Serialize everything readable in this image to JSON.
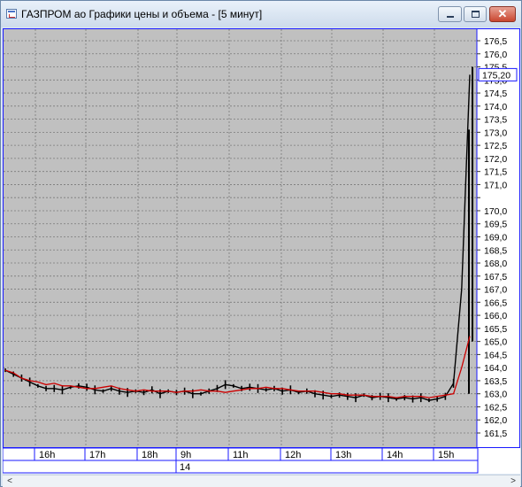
{
  "window": {
    "title": "ГАЗПРОМ ао Графики цены и объема - [5 минут]",
    "close_glyph": "✕",
    "scroll_left": "<",
    "scroll_right": ">"
  },
  "chart_data": {
    "type": "line",
    "title": "",
    "ylim": [
      161.2,
      176.8
    ],
    "y_ticks": [
      "176,5",
      "176,0",
      "175,5",
      "175,0",
      "174,5",
      "174,0",
      "173,5",
      "173,0",
      "172,5",
      "172,0",
      "171,5",
      "171,0",
      "170,0",
      "169,5",
      "169,0",
      "168,5",
      "168,0",
      "167,5",
      "167,0",
      "166,5",
      "166,0",
      "165,5",
      "165,0",
      "164,5",
      "164,0",
      "163,5",
      "163,0",
      "162,5",
      "162,0",
      "161,5"
    ],
    "y_tick_values": [
      176.5,
      176.0,
      175.5,
      175.0,
      174.5,
      174.0,
      173.5,
      173.0,
      172.5,
      172.0,
      171.5,
      171.0,
      170.0,
      169.5,
      169.0,
      168.5,
      168.0,
      167.5,
      167.0,
      166.5,
      166.0,
      165.5,
      165.0,
      164.5,
      164.0,
      163.5,
      163.0,
      162.5,
      162.0,
      161.5
    ],
    "x_session_labels": [
      "16h",
      "17h",
      "18h",
      "9h",
      "11h",
      "12h",
      "13h",
      "14h",
      "15h"
    ],
    "x_date_label": "14",
    "last_price_label": "175,20",
    "last_price": 175.2,
    "grid": true,
    "colors": {
      "background": "#c0c0c0",
      "grid": "#7a7a7a",
      "price": "#000000",
      "average": "#cc0000",
      "axis_frame": "#1a1aff"
    },
    "series": [
      {
        "values": [
          163.9,
          163.8,
          163.6,
          163.5,
          163.45,
          163.35,
          163.4,
          163.3,
          163.3,
          163.25,
          163.2,
          163.2,
          163.25,
          163.3,
          163.2,
          163.15,
          163.1,
          163.15,
          163.1,
          163.1,
          163.1,
          163.05,
          163.1,
          163.1,
          163.15,
          163.1,
          163.1,
          163.05,
          163.1,
          163.15,
          163.2,
          163.2,
          163.25,
          163.2,
          163.2,
          163.15,
          163.1,
          163.1,
          163.1,
          163.05,
          163.0,
          163.0,
          162.95,
          162.95,
          162.95,
          162.9,
          162.9,
          162.9,
          162.85,
          162.9,
          162.9,
          162.9,
          162.85,
          162.9,
          162.95,
          163.0,
          164.0,
          165.2
        ]
      },
      {
        "values": [
          163.9,
          163.75,
          163.6,
          163.45,
          163.3,
          163.2,
          163.2,
          163.15,
          163.25,
          163.3,
          163.25,
          163.15,
          163.1,
          163.2,
          163.1,
          163.05,
          163.1,
          163.05,
          163.15,
          163.0,
          163.1,
          163.05,
          163.1,
          163.0,
          163.0,
          163.1,
          163.2,
          163.35,
          163.3,
          163.2,
          163.25,
          163.2,
          163.15,
          163.2,
          163.1,
          163.15,
          163.05,
          163.1,
          163.0,
          162.95,
          162.9,
          162.95,
          162.9,
          162.85,
          162.95,
          162.85,
          162.9,
          162.85,
          162.8,
          162.85,
          162.8,
          162.85,
          162.75,
          162.8,
          162.9,
          163.4,
          167.0,
          175.2
        ]
      }
    ]
  }
}
